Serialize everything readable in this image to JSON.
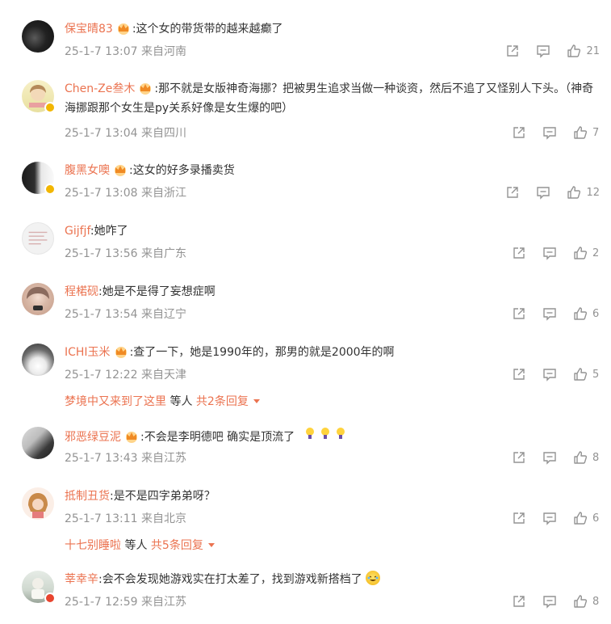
{
  "colors": {
    "name": "#eb7350",
    "meta": "#939393",
    "text": "#333333",
    "badge": "#f2b600"
  },
  "comments": [
    {
      "name": "保宝晴83",
      "text": ":这个女的带货带的越来越癫了",
      "time": "25-1-7 13:07",
      "location": "来自河南",
      "likes": "21",
      "crown": true,
      "verified": false
    },
    {
      "name": "Chen-Ze叁木",
      "text": ":那不就是女版神奇海挪？把被男生追求当做一种谈资，然后不追了又怪别人下头。（神奇海挪跟那个女生是py关系好像是女生爆的吧）",
      "time": "25-1-7 13:04",
      "location": "来自四川",
      "likes": "7",
      "crown": true,
      "verified": true
    },
    {
      "name": "腹黑女噢",
      "text": ":这女的好多录播卖货",
      "time": "25-1-7 13:08",
      "location": "来自浙江",
      "likes": "12",
      "crown": true,
      "verified": true
    },
    {
      "name": "Gijfjf",
      "text": ":她咋了",
      "time": "25-1-7 13:56",
      "location": "来自广东",
      "likes": "2",
      "crown": false,
      "verified": false
    },
    {
      "name": "程楉砚",
      "text": ":她是不是得了妄想症啊",
      "time": "25-1-7 13:54",
      "location": "来自辽宁",
      "likes": "6",
      "crown": false,
      "verified": false
    },
    {
      "name": "ICHI玉米",
      "text": ":查了一下，她是1990年的，那男的就是2000年的啊",
      "time": "25-1-7 12:22",
      "location": "来自天津",
      "likes": "5",
      "crown": true,
      "verified": false,
      "replies": {
        "name": "梦境中又来到了这里",
        "mid": "等人",
        "total": "共2条回复"
      }
    },
    {
      "name": "邪恶绿豆泥",
      "text": ":不会是李明德吧 确实是顶流了",
      "time": "25-1-7 13:43",
      "location": "来自江苏",
      "likes": "8",
      "crown": true,
      "verified": false,
      "emoji_trail": "bulbs"
    },
    {
      "name": "抵制丑货",
      "text": ":是不是四字弟弟呀？",
      "time": "25-1-7 13:11",
      "location": "来自北京",
      "likes": "6",
      "crown": false,
      "verified": false,
      "replies": {
        "name": "十七别睡啦",
        "mid": "等人",
        "total": "共5条回复"
      }
    },
    {
      "name": "莘幸辛",
      "text": ":会不会发现她游戏实在打太差了，找到游戏新搭档了",
      "time": "25-1-7 12:59",
      "location": "来自江苏",
      "likes": "8",
      "crown": false,
      "verified": false,
      "emoji_trail": "laugh"
    }
  ]
}
